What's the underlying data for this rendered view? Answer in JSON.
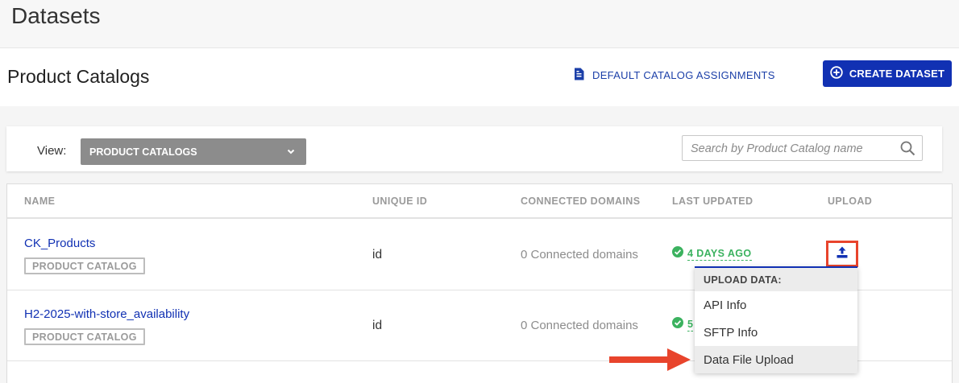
{
  "app": {
    "title": "Datasets"
  },
  "page": {
    "title": "Product Catalogs",
    "link_button": "DEFAULT CATALOG ASSIGNMENTS",
    "create_button": "CREATE DATASET"
  },
  "filter": {
    "view_label": "View:",
    "view_value": "PRODUCT CATALOGS",
    "search_placeholder": "Search by Product Catalog name"
  },
  "table": {
    "columns": [
      "NAME",
      "UNIQUE ID",
      "CONNECTED DOMAINS",
      "LAST UPDATED",
      "UPLOAD"
    ],
    "rows": [
      {
        "name": "CK_Products",
        "type": "PRODUCT CATALOG",
        "unique_id": "id",
        "domains": "0 Connected domains",
        "updated": "4 DAYS AGO"
      },
      {
        "name": "H2-2025-with-store_availability",
        "type": "PRODUCT CATALOG",
        "unique_id": "id",
        "domains": "0 Connected domains",
        "updated": "5"
      }
    ]
  },
  "upload_menu": {
    "header": "UPLOAD DATA:",
    "items": [
      "API Info",
      "SFTP Info",
      "Data File Upload"
    ]
  },
  "colors": {
    "primary": "#1131b3",
    "success": "#3bb25f",
    "highlight": "#e8442c"
  },
  "icons": {
    "link_button": "document-icon",
    "create_button": "plus-circle-icon",
    "select": "chevron-down-icon",
    "search": "search-icon",
    "status": "check-circle-icon",
    "upload": "upload-icon",
    "annotation": "arrow-right-icon"
  }
}
